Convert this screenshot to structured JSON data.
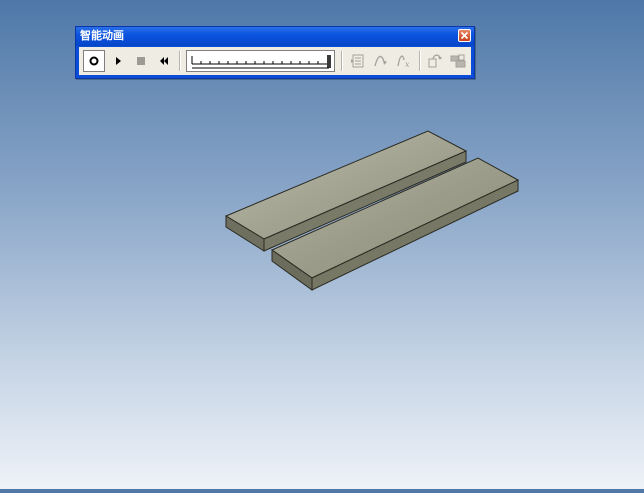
{
  "window": {
    "title": "智能动画"
  },
  "toolbar": {
    "buttons": [
      {
        "id": "record",
        "icon": "record-icon",
        "state": "pressed"
      },
      {
        "id": "play",
        "icon": "play-icon"
      },
      {
        "id": "stop",
        "icon": "stop-icon",
        "state": "disabled"
      },
      {
        "id": "rewind",
        "icon": "rewind-icon"
      },
      {
        "id": "keyframe",
        "icon": "keyframe-icon",
        "state": "disabled"
      },
      {
        "id": "path",
        "icon": "path-curve-icon",
        "state": "disabled"
      },
      {
        "id": "path-edit",
        "icon": "path-function-icon",
        "state": "disabled"
      },
      {
        "id": "settings",
        "icon": "animation-settings-icon",
        "state": "disabled"
      },
      {
        "id": "properties",
        "icon": "properties-icon",
        "state": "disabled"
      }
    ],
    "timeline": {
      "icon": "timeline-slider",
      "position": 1.0
    }
  },
  "scene": {
    "objects": [
      {
        "name": "plate-1",
        "color": "#9f9f8c"
      },
      {
        "name": "plate-2",
        "color": "#9f9f8c"
      }
    ],
    "background_top": "#4f78a8",
    "background_bottom": "#eef2f8"
  }
}
